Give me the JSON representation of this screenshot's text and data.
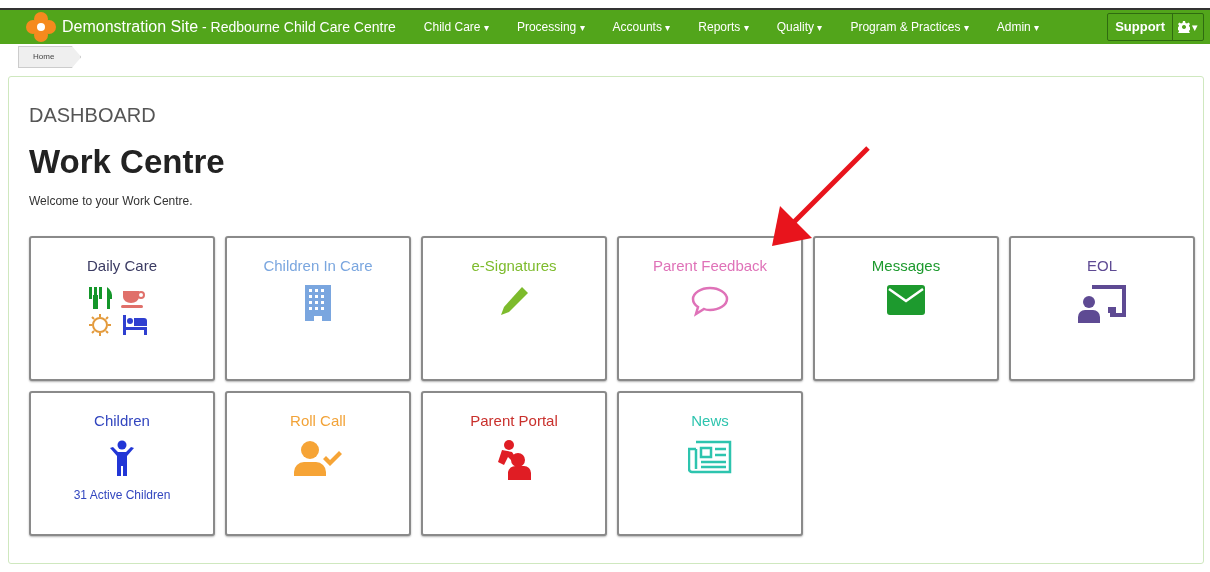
{
  "navbar": {
    "site": "Demonstration Site",
    "subtitle": "- Redbourne Child Care Centre",
    "menu": [
      {
        "label": "Child Care",
        "caret": "▾"
      },
      {
        "label": "Processing",
        "caret": "▾"
      },
      {
        "label": "Accounts",
        "caret": "▾"
      },
      {
        "label": "Reports",
        "caret": "▾"
      },
      {
        "label": "Quality",
        "caret": "▾"
      },
      {
        "label": "Program & Practices",
        "caret": "▾"
      },
      {
        "label": "Admin",
        "caret": "▾"
      }
    ],
    "support": "Support",
    "settings_caret": "▾"
  },
  "breadcrumb": [
    "Home"
  ],
  "page": {
    "section": "DASHBOARD",
    "title": "Work Centre",
    "subtitle": "Welcome to your Work Centre."
  },
  "tiles": [
    {
      "label": "Daily Care",
      "color": "#3b3b63"
    },
    {
      "label": "Children In Care",
      "color": "#7aa6df"
    },
    {
      "label": "e-Signatures",
      "color": "#7dbb2c"
    },
    {
      "label": "Parent Feedback",
      "color": "#df72b8"
    },
    {
      "label": "Messages",
      "color": "#1d9a2e"
    },
    {
      "label": "EOL",
      "color": "#5e4a93"
    },
    {
      "label": "Children",
      "color": "#3246bf",
      "note": "31 Active Children"
    },
    {
      "label": "Roll Call",
      "color": "#f2a338"
    },
    {
      "label": "Parent Portal",
      "color": "#c9302c"
    },
    {
      "label": "News",
      "color": "#2dc4ae"
    }
  ]
}
